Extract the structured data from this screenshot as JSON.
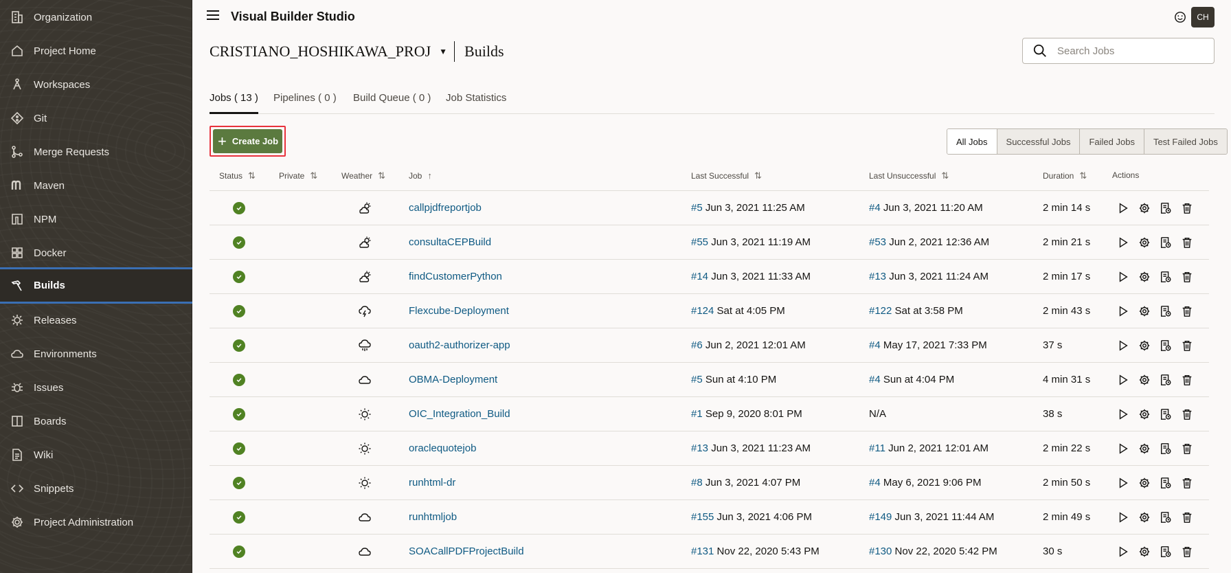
{
  "app": {
    "title": "Visual Builder Studio",
    "avatar": "CH"
  },
  "sidebar": {
    "items": [
      {
        "label": "Organization",
        "icon": "building-icon"
      },
      {
        "label": "Project Home",
        "icon": "home-icon"
      },
      {
        "label": "Workspaces",
        "icon": "compass-icon"
      },
      {
        "label": "Git",
        "icon": "git-icon"
      },
      {
        "label": "Merge Requests",
        "icon": "merge-icon"
      },
      {
        "label": "Maven",
        "icon": "maven-icon"
      },
      {
        "label": "NPM",
        "icon": "npm-icon"
      },
      {
        "label": "Docker",
        "icon": "docker-icon"
      },
      {
        "label": "Builds",
        "icon": "hammer-icon",
        "active": true
      },
      {
        "label": "Releases",
        "icon": "badge-icon"
      },
      {
        "label": "Environments",
        "icon": "cloud-icon"
      },
      {
        "label": "Issues",
        "icon": "bug-icon"
      },
      {
        "label": "Boards",
        "icon": "board-icon"
      },
      {
        "label": "Wiki",
        "icon": "document-icon"
      },
      {
        "label": "Snippets",
        "icon": "code-icon"
      },
      {
        "label": "Project Administration",
        "icon": "gear-icon"
      }
    ]
  },
  "header": {
    "project": "CRISTIANO_HOSHIKAWA_PROJ",
    "page": "Builds"
  },
  "search": {
    "placeholder": "Search Jobs"
  },
  "tabs": [
    "Jobs ( 13 )",
    "Pipelines ( 0 )",
    "Build Queue ( 0 )",
    "Job Statistics"
  ],
  "create_job": "Create Job",
  "filters": [
    "All Jobs",
    "Successful Jobs",
    "Failed Jobs",
    "Test Failed Jobs"
  ],
  "columns": {
    "status": "Status",
    "private": "Private",
    "weather": "Weather",
    "job": "Job",
    "last_successful": "Last Successful",
    "last_unsuccessful": "Last Unsuccessful",
    "duration": "Duration",
    "actions": "Actions"
  },
  "rows": [
    {
      "job": "callpjdfreportjob",
      "weather": "partly-cloudy",
      "ls_num": "#5",
      "ls_date": "Jun 3, 2021 11:25 AM",
      "lu_num": "#4",
      "lu_date": "Jun 3, 2021 11:20 AM",
      "duration": "2 min 14 s"
    },
    {
      "job": "consultaCEPBuild",
      "weather": "partly-cloudy",
      "ls_num": "#55",
      "ls_date": "Jun 3, 2021 11:19 AM",
      "lu_num": "#53",
      "lu_date": "Jun 2, 2021 12:36 AM",
      "duration": "2 min 21 s"
    },
    {
      "job": "findCustomerPython",
      "weather": "partly-cloudy",
      "ls_num": "#14",
      "ls_date": "Jun 3, 2021 11:33 AM",
      "lu_num": "#13",
      "lu_date": "Jun 3, 2021 11:24 AM",
      "duration": "2 min 17 s"
    },
    {
      "job": "Flexcube-Deployment",
      "weather": "storm",
      "ls_num": "#124",
      "ls_date": "Sat at 4:05 PM",
      "lu_num": "#122",
      "lu_date": "Sat at 3:58 PM",
      "duration": "2 min 43 s"
    },
    {
      "job": "oauth2-authorizer-app",
      "weather": "rain",
      "ls_num": "#6",
      "ls_date": "Jun 2, 2021 12:01 AM",
      "lu_num": "#4",
      "lu_date": "May 17, 2021 7:33 PM",
      "duration": "37 s"
    },
    {
      "job": "OBMA-Deployment",
      "weather": "cloudy",
      "ls_num": "#5",
      "ls_date": "Sun at 4:10 PM",
      "lu_num": "#4",
      "lu_date": "Sun at 4:04 PM",
      "duration": "4 min 31 s"
    },
    {
      "job": "OIC_Integration_Build",
      "weather": "sunny",
      "ls_num": "#1",
      "ls_date": "Sep 9, 2020 8:01 PM",
      "lu_num": "",
      "lu_date": "N/A",
      "duration": "38 s"
    },
    {
      "job": "oraclequotejob",
      "weather": "sunny",
      "ls_num": "#13",
      "ls_date": "Jun 3, 2021 11:23 AM",
      "lu_num": "#11",
      "lu_date": "Jun 2, 2021 12:01 AM",
      "duration": "2 min 22 s"
    },
    {
      "job": "runhtml-dr",
      "weather": "sunny",
      "ls_num": "#8",
      "ls_date": "Jun 3, 2021 4:07 PM",
      "lu_num": "#4",
      "lu_date": "May 6, 2021 9:06 PM",
      "duration": "2 min 50 s"
    },
    {
      "job": "runhtmljob",
      "weather": "cloudy",
      "ls_num": "#155",
      "ls_date": "Jun 3, 2021 4:06 PM",
      "lu_num": "#149",
      "lu_date": "Jun 3, 2021 11:44 AM",
      "duration": "2 min 49 s"
    },
    {
      "job": "SOACallPDFProjectBuild",
      "weather": "cloudy",
      "ls_num": "#131",
      "ls_date": "Nov 22, 2020 5:43 PM",
      "lu_num": "#130",
      "lu_date": "Nov 22, 2020 5:42 PM",
      "duration": "30 s"
    }
  ],
  "colors": {
    "sidebar": "#3a362f",
    "accent": "#3a6fb4",
    "create": "#5b7a3f",
    "link": "#0f5a83",
    "success": "#508223",
    "highlight": "#e8323c"
  }
}
